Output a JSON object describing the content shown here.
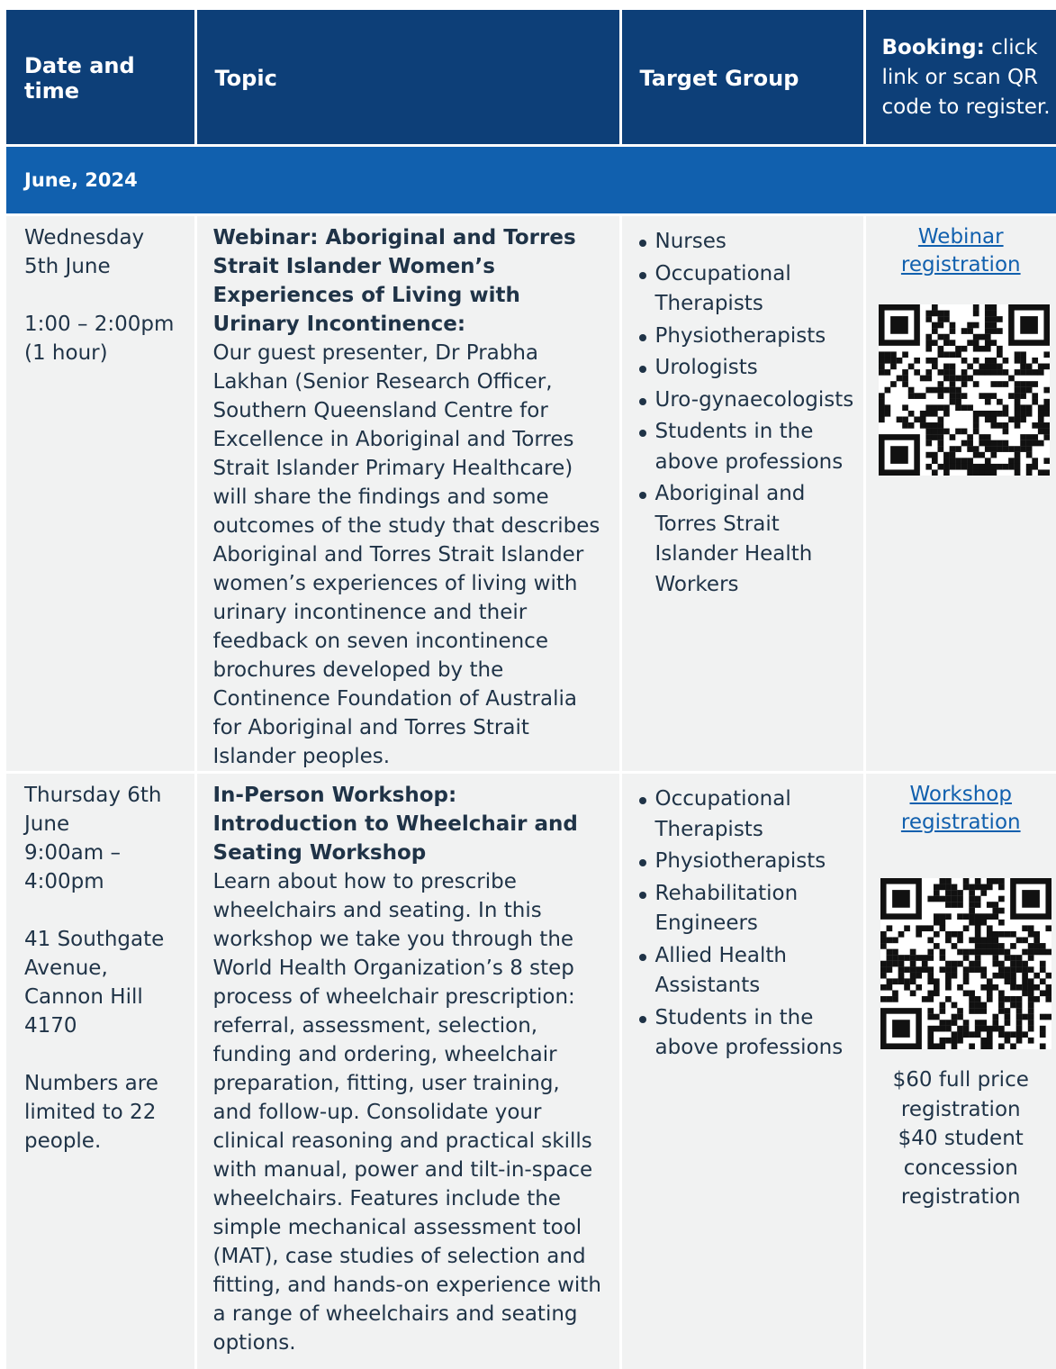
{
  "header": {
    "col_date": "Date and time",
    "col_topic": "Topic",
    "col_target": "Target Group",
    "col_booking_bold": "Booking:",
    "col_booking_rest": " click link or scan QR code to register."
  },
  "month": "June, 2024",
  "events": [
    {
      "date_line1": "Wednesday",
      "date_line2": "5th June",
      "time": "1:00 – 2:00pm",
      "duration": "(1 hour)",
      "title": "Webinar: Aboriginal and Torres Strait Islander Women’s Experiences of Living with Urinary Incontinence:",
      "description": "Our guest presenter, Dr Prabha Lakhan (Senior Research Officer, Southern Queensland Centre for Excellence in Aboriginal and Torres Strait Islander Primary Healthcare) will share the findings and some outcomes of the study that describes Aboriginal and Torres Strait Islander women’s experiences of living with urinary incontinence and their feedback on seven incontinence brochures developed by the Continence Foundation of Australia for Aboriginal and Torres Strait Islander peoples.",
      "targets": [
        "Nurses",
        "Occupational Therapists",
        "Physiotherapists",
        "Urologists",
        "Uro-gynaecologists",
        "Students in the above professions",
        "Aboriginal and Torres Strait Islander Health Workers"
      ],
      "link_text": "Webinar registration"
    },
    {
      "date_line1": "Thursday 6th June",
      "time": "9:00am – 4:00pm",
      "address": "41 Southgate Avenue, Cannon Hill 4170",
      "note": "Numbers are limited to 22 people.",
      "title": "In-Person Workshop: Introduction to Wheelchair and Seating Workshop",
      "description": "Learn about how to prescribe wheelchairs and seating. In this workshop we take you through the World Health Organization’s 8 step process of wheelchair prescription: referral, assessment, selection, funding and ordering, wheelchair preparation, fitting, user training, and follow-up. Consolidate your clinical reasoning and practical skills with manual, power and tilt-in-space wheelchairs. Features include the simple mechanical assessment tool (MAT), case studies of selection and fitting, and hands-on experience with a range of wheelchairs and seating options.",
      "targets": [
        "Occupational Therapists",
        "Physiotherapists",
        "Rehabilitation Engineers",
        "Allied Health Assistants",
        "Students in the above professions"
      ],
      "link_text": "Workshop registration",
      "price_full": "$60 full price registration",
      "price_student": "$40 student concession registration"
    }
  ]
}
